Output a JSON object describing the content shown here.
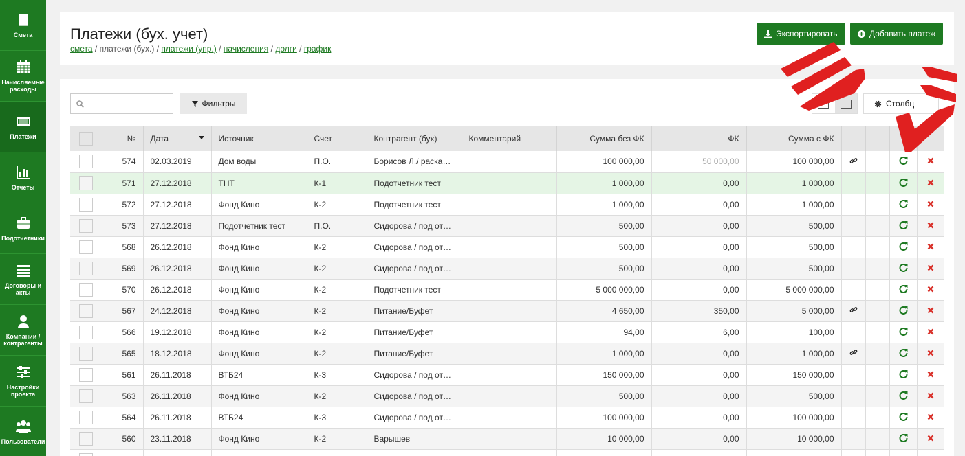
{
  "sidebar": {
    "items": [
      {
        "label": "Смета",
        "icon": "book-icon",
        "active": false
      },
      {
        "label": "Начисляемые расходы",
        "icon": "calendar-icon",
        "active": false
      },
      {
        "label": "Платежи",
        "icon": "money-icon",
        "active": true
      },
      {
        "label": "Отчеты",
        "icon": "bar-chart-icon",
        "active": false
      },
      {
        "label": "Подотчетники",
        "icon": "briefcase-icon",
        "active": false
      },
      {
        "label": "Договоры и акты",
        "icon": "list-icon",
        "active": false
      },
      {
        "label": "Компании / контрагенты",
        "icon": "user-icon",
        "active": false
      },
      {
        "label": "Настройки проекта",
        "icon": "sliders-icon",
        "active": false
      },
      {
        "label": "Пользователи",
        "icon": "users-icon",
        "active": false
      }
    ]
  },
  "header": {
    "title": "Платежи (бух. учет)",
    "breadcrumb": {
      "smeta": "смета",
      "sep1": " / ",
      "current": "платежи (бух.)",
      "sep2": " / ",
      "upr": "платежи (упр.)",
      "sep3": " / ",
      "nach": "начисления",
      "sep4": " / ",
      "dolgi": "долги",
      "sep5": " / ",
      "grafik": "график"
    },
    "export_label": "Экспортировать",
    "add_label": "Добавить платеж"
  },
  "toolbar": {
    "search_placeholder": "",
    "filters_label": "Фильтры",
    "columns_label": "Столбц"
  },
  "table": {
    "headers": {
      "num": "№",
      "date": "Дата",
      "source": "Источник",
      "account": "Счет",
      "counterparty": "Контрагент (бух)",
      "comment": "Комментарий",
      "sum_no_fk": "Сумма без ФК",
      "fk": "ФК",
      "sum_fk": "Сумма с ФК"
    },
    "rows": [
      {
        "num": "574",
        "date": "02.03.2019",
        "source": "Дом воды",
        "account": "П.О.",
        "counterparty": "Борисов Л./ раскадровка",
        "comment": "",
        "sum_no_fk": "100 000,00",
        "fk": "50 000,00",
        "sum_fk": "100 000,00",
        "link": true,
        "fk_muted": true,
        "style": "plain"
      },
      {
        "num": "571",
        "date": "27.12.2018",
        "source": "ТНТ",
        "account": "К-1",
        "counterparty": "Подотчетник тест",
        "comment": "",
        "sum_no_fk": "1 000,00",
        "fk": "0,00",
        "sum_fk": "1 000,00",
        "link": false,
        "fk_muted": false,
        "style": "hl"
      },
      {
        "num": "572",
        "date": "27.12.2018",
        "source": "Фонд Кино",
        "account": "К-2",
        "counterparty": "Подотчетник тест",
        "comment": "",
        "sum_no_fk": "1 000,00",
        "fk": "0,00",
        "sum_fk": "1 000,00",
        "link": false,
        "fk_muted": false,
        "style": "plain"
      },
      {
        "num": "573",
        "date": "27.12.2018",
        "source": "Подотчетник тест",
        "account": "П.О.",
        "counterparty": "Сидорова / под отчет",
        "comment": "",
        "sum_no_fk": "500,00",
        "fk": "0,00",
        "sum_fk": "500,00",
        "link": false,
        "fk_muted": false,
        "style": "alt"
      },
      {
        "num": "568",
        "date": "26.12.2018",
        "source": "Фонд Кино",
        "account": "К-2",
        "counterparty": "Сидорова / под отчет",
        "comment": "",
        "sum_no_fk": "500,00",
        "fk": "0,00",
        "sum_fk": "500,00",
        "link": false,
        "fk_muted": false,
        "style": "plain"
      },
      {
        "num": "569",
        "date": "26.12.2018",
        "source": "Фонд Кино",
        "account": "К-2",
        "counterparty": "Сидорова / под отчет",
        "comment": "",
        "sum_no_fk": "500,00",
        "fk": "0,00",
        "sum_fk": "500,00",
        "link": false,
        "fk_muted": false,
        "style": "alt"
      },
      {
        "num": "570",
        "date": "26.12.2018",
        "source": "Фонд Кино",
        "account": "К-2",
        "counterparty": "Подотчетник тест",
        "comment": "",
        "sum_no_fk": "5 000 000,00",
        "fk": "0,00",
        "sum_fk": "5 000 000,00",
        "link": false,
        "fk_muted": false,
        "style": "plain"
      },
      {
        "num": "567",
        "date": "24.12.2018",
        "source": "Фонд Кино",
        "account": "К-2",
        "counterparty": "Питание/Буфет",
        "comment": "",
        "sum_no_fk": "4 650,00",
        "fk": "350,00",
        "sum_fk": "5 000,00",
        "link": true,
        "fk_muted": false,
        "style": "alt"
      },
      {
        "num": "566",
        "date": "19.12.2018",
        "source": "Фонд Кино",
        "account": "К-2",
        "counterparty": "Питание/Буфет",
        "comment": "",
        "sum_no_fk": "94,00",
        "fk": "6,00",
        "sum_fk": "100,00",
        "link": false,
        "fk_muted": false,
        "style": "plain"
      },
      {
        "num": "565",
        "date": "18.12.2018",
        "source": "Фонд Кино",
        "account": "К-2",
        "counterparty": "Питание/Буфет",
        "comment": "",
        "sum_no_fk": "1 000,00",
        "fk": "0,00",
        "sum_fk": "1 000,00",
        "link": true,
        "fk_muted": false,
        "style": "alt"
      },
      {
        "num": "561",
        "date": "26.11.2018",
        "source": "ВТБ24",
        "account": "К-3",
        "counterparty": "Сидорова / под отчет",
        "comment": "",
        "sum_no_fk": "150 000,00",
        "fk": "0,00",
        "sum_fk": "150 000,00",
        "link": false,
        "fk_muted": false,
        "style": "plain"
      },
      {
        "num": "563",
        "date": "26.11.2018",
        "source": "Фонд Кино",
        "account": "К-2",
        "counterparty": "Сидорова / под отчет",
        "comment": "",
        "sum_no_fk": "500,00",
        "fk": "0,00",
        "sum_fk": "500,00",
        "link": false,
        "fk_muted": false,
        "style": "alt"
      },
      {
        "num": "564",
        "date": "26.11.2018",
        "source": "ВТБ24",
        "account": "К-3",
        "counterparty": "Сидорова / под отчет",
        "comment": "",
        "sum_no_fk": "100 000,00",
        "fk": "0,00",
        "sum_fk": "100 000,00",
        "link": false,
        "fk_muted": false,
        "style": "plain"
      },
      {
        "num": "560",
        "date": "23.11.2018",
        "source": "Фонд Кино",
        "account": "К-2",
        "counterparty": "Варышев",
        "comment": "",
        "sum_no_fk": "10 000,00",
        "fk": "0,00",
        "sum_fk": "10 000,00",
        "link": false,
        "fk_muted": false,
        "style": "alt"
      },
      {
        "num": "",
        "date": "",
        "source": "",
        "account": "",
        "counterparty": "",
        "comment": "",
        "sum_no_fk": "",
        "fk": "",
        "sum_fk": "",
        "link": false,
        "fk_muted": false,
        "style": "plain"
      }
    ]
  },
  "colors": {
    "brand_green": "#1e7a22",
    "delete_red": "#d9322b",
    "arrow_red": "#e02020"
  }
}
